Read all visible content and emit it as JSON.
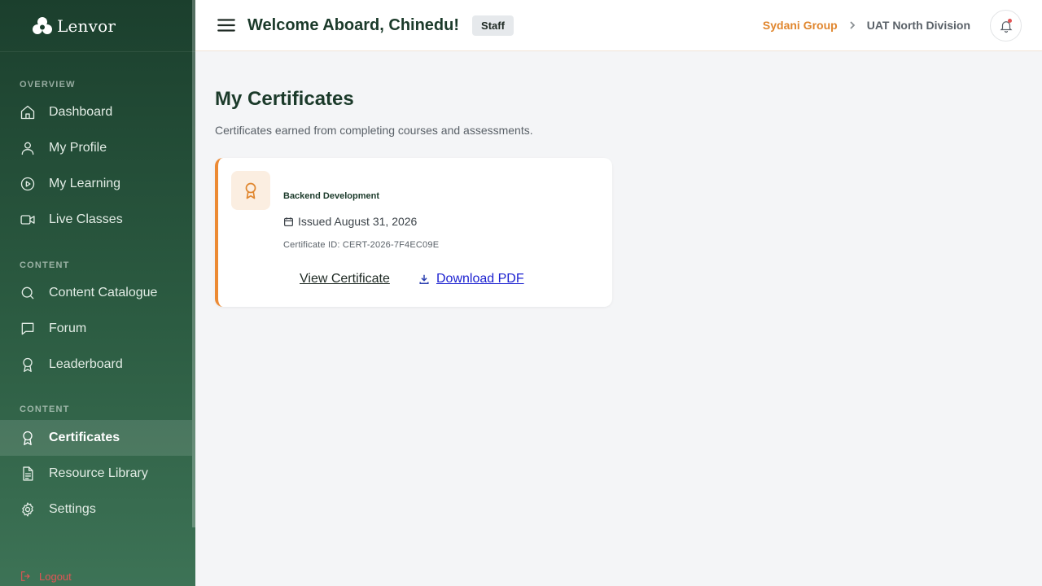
{
  "brand": {
    "name": "Lenvor"
  },
  "sidebar": {
    "sections": [
      {
        "label": "OVERVIEW"
      },
      {
        "label": "CONTENT"
      },
      {
        "label": "CONTENT"
      }
    ],
    "items": [
      {
        "label": "Dashboard",
        "icon": "home-icon"
      },
      {
        "label": "My Profile",
        "icon": "user-icon"
      },
      {
        "label": "My Learning",
        "icon": "play-circle-icon"
      },
      {
        "label": "Live Classes",
        "icon": "video-icon"
      },
      {
        "label": "Content Catalogue",
        "icon": "search-icon"
      },
      {
        "label": "Forum",
        "icon": "chat-icon"
      },
      {
        "label": "Leaderboard",
        "icon": "award-icon"
      },
      {
        "label": "Certificates",
        "icon": "award-icon",
        "active": true
      },
      {
        "label": "Resource Library",
        "icon": "document-icon"
      },
      {
        "label": "Settings",
        "icon": "gear-icon"
      }
    ],
    "logout_label": "Logout"
  },
  "header": {
    "welcome": "Welcome Aboard, Chinedu!",
    "role": "Staff",
    "org": "Sydani Group",
    "division": "UAT North Division"
  },
  "main": {
    "title": "My Certificates",
    "subtitle": "Certificates earned from completing courses and assessments.",
    "certificates": [
      {
        "course": "Backend Development",
        "issued": "Issued August 31, 2026",
        "cert_id": "Certificate ID: CERT-2026-7F4EC09E",
        "view_label": "View Certificate",
        "download_label": "Download PDF"
      }
    ]
  },
  "colors": {
    "accent": "#e0862e",
    "sidebar_dark": "#1b3f2d",
    "sidebar_light": "#3d7356",
    "link": "#1a1fd0",
    "danger": "#e25555"
  }
}
